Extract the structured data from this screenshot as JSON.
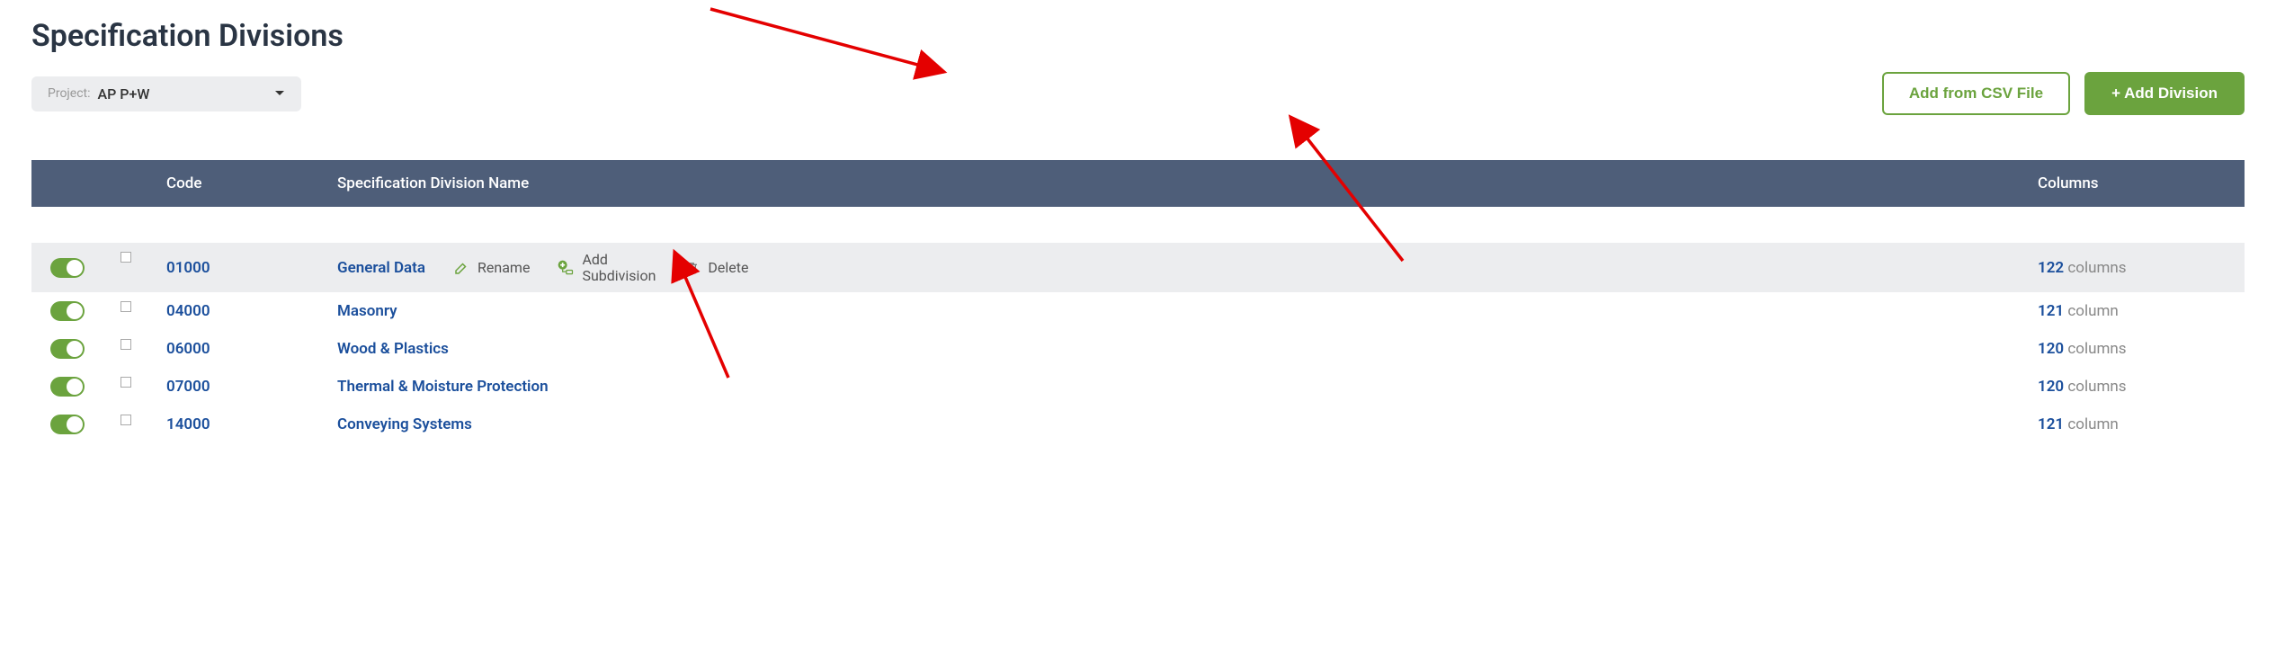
{
  "title": "Specification Divisions",
  "project": {
    "label": "Project:",
    "value": "AP P+W"
  },
  "buttons": {
    "add_csv": "Add from CSV File",
    "add_division": "+ Add Division"
  },
  "headers": {
    "code": "Code",
    "name": "Specification Division Name",
    "columns": "Columns"
  },
  "row_actions": {
    "rename": "Rename",
    "add_sub_line1": "Add",
    "add_sub_line2": "Subdivision",
    "delete": "Delete"
  },
  "rows": [
    {
      "code": "01000",
      "name": "General Data",
      "count": "122",
      "unit": "columns",
      "hovered": true
    },
    {
      "code": "04000",
      "name": "Masonry",
      "count": "121",
      "unit": "column",
      "hovered": false
    },
    {
      "code": "06000",
      "name": "Wood & Plastics",
      "count": "120",
      "unit": "columns",
      "hovered": false
    },
    {
      "code": "07000",
      "name": "Thermal & Moisture Protection",
      "count": "120",
      "unit": "columns",
      "hovered": false
    },
    {
      "code": "14000",
      "name": "Conveying Systems",
      "count": "121",
      "unit": "column",
      "hovered": false
    }
  ]
}
